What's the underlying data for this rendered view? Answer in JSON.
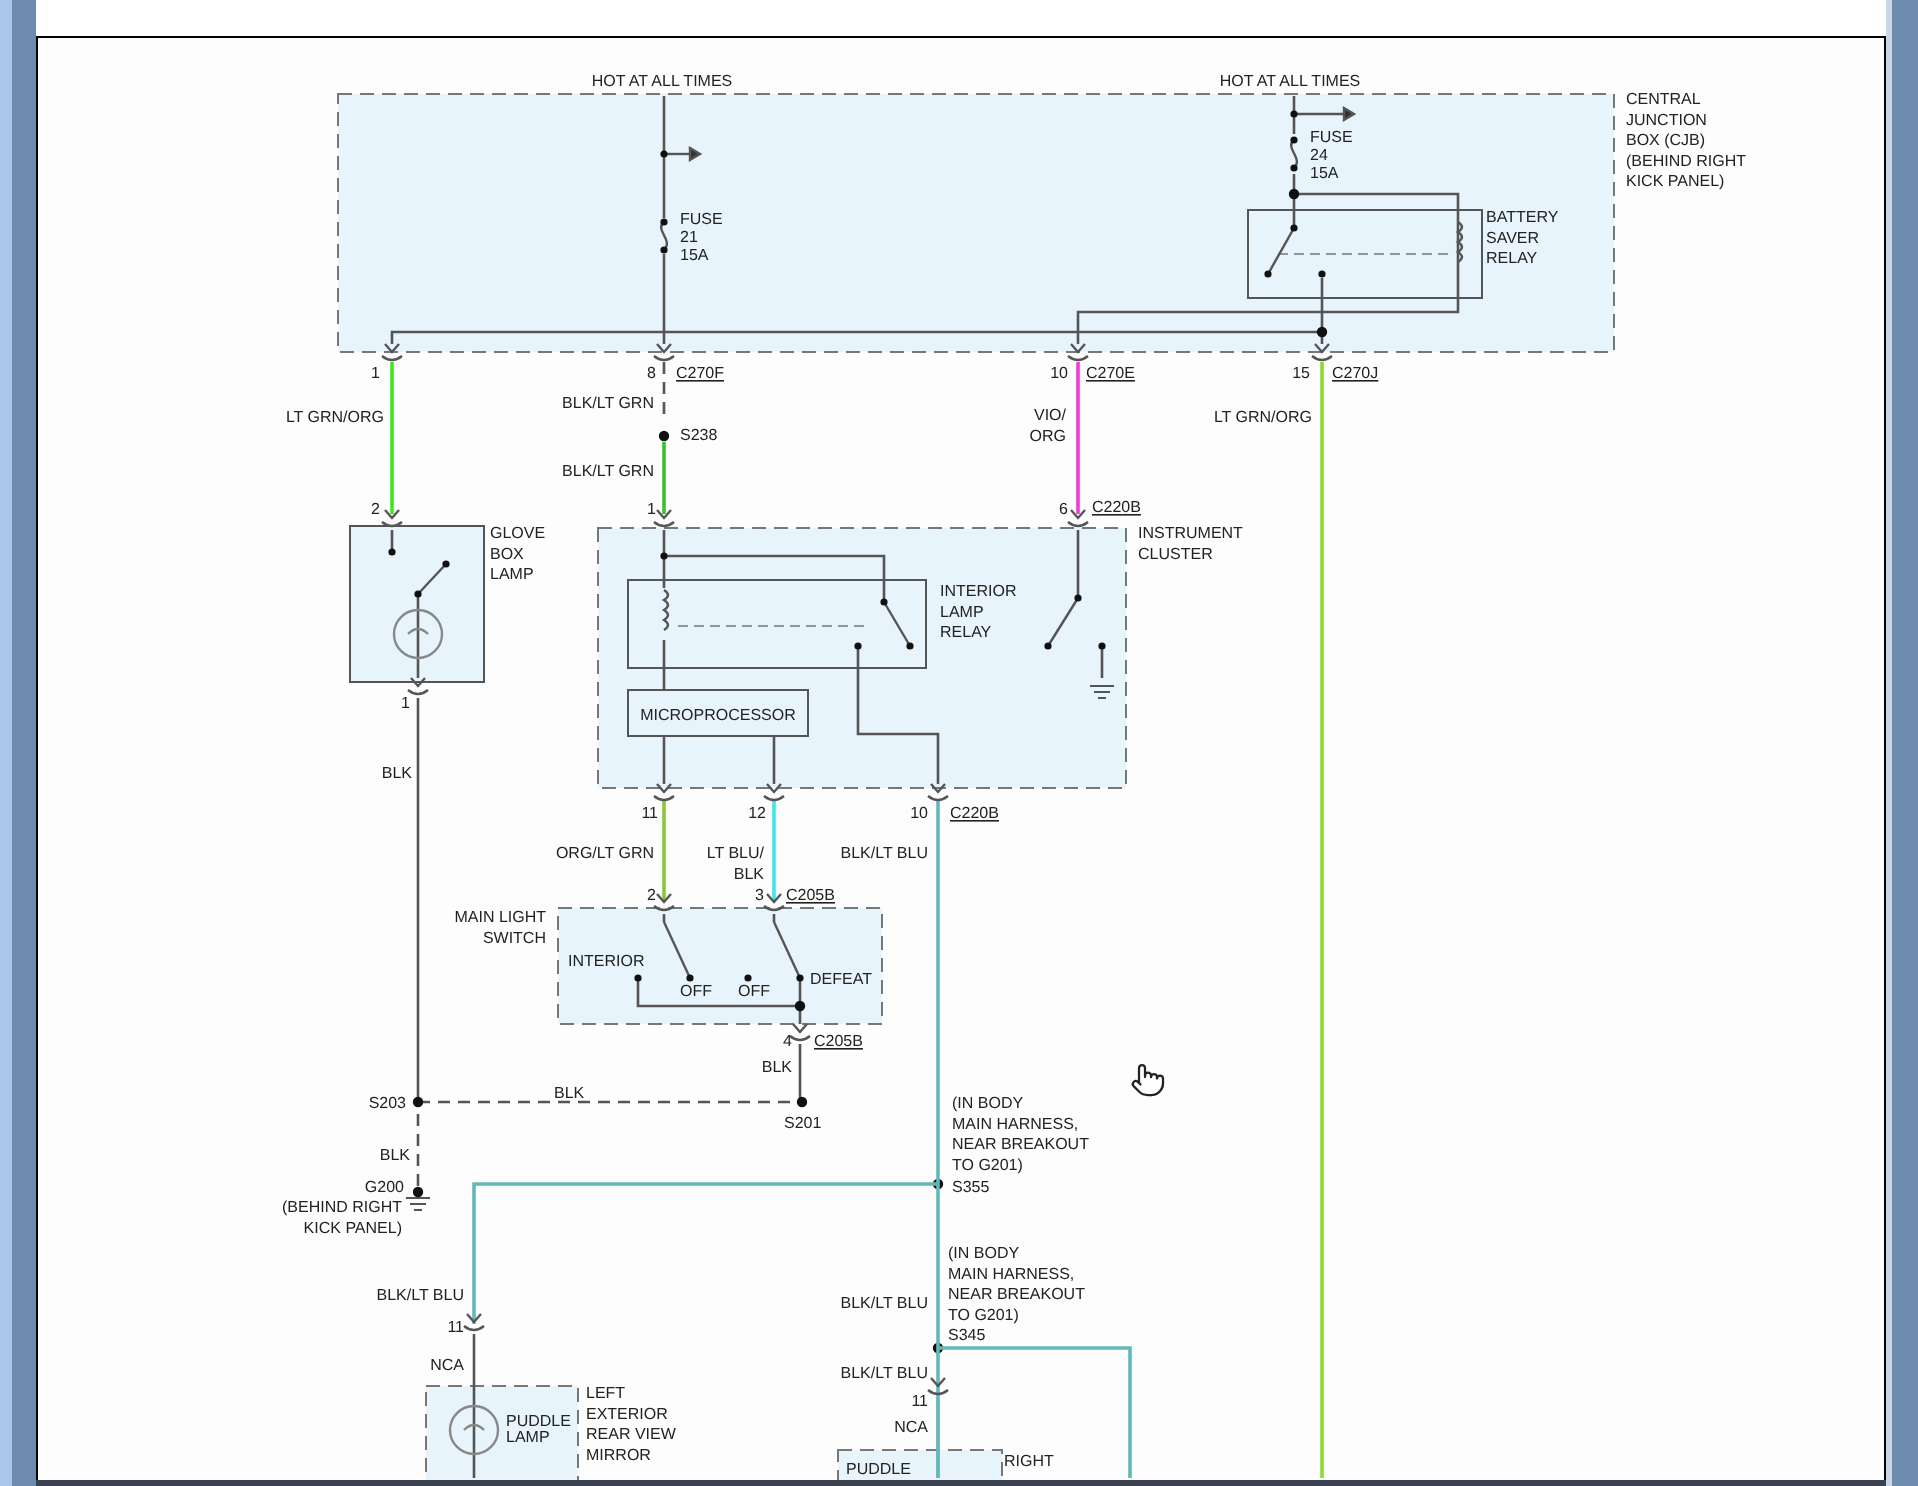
{
  "diagram": {
    "wires": [
      {
        "color": "#3fe61e"
      },
      {
        "color": "#35c22a"
      },
      {
        "color": "#f23ad8"
      },
      {
        "color": "#8fd92e"
      },
      {
        "color": "#86c83a"
      },
      {
        "color": "#3ee8e8"
      },
      {
        "color": "#63b8b8"
      }
    ],
    "labels": [
      {
        "kind": "note",
        "lines": [
          "HOT AT ALL TIMES"
        ]
      },
      {
        "kind": "note",
        "lines": [
          "HOT AT ALL TIMES"
        ]
      },
      {
        "kind": "component",
        "lines": [
          "CENTRAL",
          "JUNCTION",
          "BOX (CJB)",
          "(BEHIND RIGHT",
          "KICK PANEL)"
        ]
      },
      {
        "kind": "component",
        "lines": [
          "FUSE",
          "21",
          "15A"
        ]
      },
      {
        "kind": "component",
        "lines": [
          "FUSE",
          "24",
          "15A"
        ]
      },
      {
        "kind": "component",
        "lines": [
          "BATTERY",
          "SAVER",
          "RELAY"
        ]
      },
      {
        "kind": "pin",
        "lines": [
          "1"
        ]
      },
      {
        "kind": "pin",
        "lines": [
          "8"
        ]
      },
      {
        "kind": "connector",
        "lines": [
          "C270F"
        ]
      },
      {
        "kind": "pin",
        "lines": [
          "10"
        ]
      },
      {
        "kind": "connector",
        "lines": [
          "C270E"
        ]
      },
      {
        "kind": "pin",
        "lines": [
          "15"
        ]
      },
      {
        "kind": "connector",
        "lines": [
          "C270J"
        ]
      },
      {
        "kind": "wire",
        "lines": [
          "LT GRN/ORG"
        ]
      },
      {
        "kind": "wire",
        "lines": [
          "BLK/LT GRN"
        ]
      },
      {
        "kind": "splice",
        "lines": [
          "S238"
        ]
      },
      {
        "kind": "wire",
        "lines": [
          "BLK/LT GRN"
        ]
      },
      {
        "kind": "wire",
        "lines": [
          "VIO/",
          "ORG"
        ]
      },
      {
        "kind": "wire",
        "lines": [
          "LT GRN/ORG"
        ]
      },
      {
        "kind": "pin",
        "lines": [
          "2"
        ]
      },
      {
        "kind": "pin",
        "lines": [
          "1"
        ]
      },
      {
        "kind": "pin",
        "lines": [
          "6"
        ]
      },
      {
        "kind": "connector",
        "lines": [
          "C220B"
        ]
      },
      {
        "kind": "component",
        "lines": [
          "GLOVE",
          "BOX",
          "LAMP"
        ]
      },
      {
        "kind": "component",
        "lines": [
          "INSTRUMENT",
          "CLUSTER"
        ]
      },
      {
        "kind": "component",
        "lines": [
          "INTERIOR",
          "LAMP",
          "RELAY"
        ]
      },
      {
        "kind": "component",
        "lines": [
          "MICROPROCESSOR"
        ]
      },
      {
        "kind": "pin",
        "lines": [
          "1"
        ]
      },
      {
        "kind": "wire",
        "lines": [
          "BLK"
        ]
      },
      {
        "kind": "pin",
        "lines": [
          "11"
        ]
      },
      {
        "kind": "pin",
        "lines": [
          "12"
        ]
      },
      {
        "kind": "pin",
        "lines": [
          "10"
        ]
      },
      {
        "kind": "connector",
        "lines": [
          "C220B"
        ]
      },
      {
        "kind": "wire",
        "lines": [
          "ORG/LT GRN"
        ]
      },
      {
        "kind": "wire",
        "lines": [
          "LT BLU/",
          "BLK"
        ]
      },
      {
        "kind": "wire",
        "lines": [
          "BLK/LT BLU"
        ]
      },
      {
        "kind": "pin",
        "lines": [
          "2"
        ]
      },
      {
        "kind": "pin",
        "lines": [
          "3"
        ]
      },
      {
        "kind": "connector",
        "lines": [
          "C205B"
        ]
      },
      {
        "kind": "component",
        "lines": [
          "MAIN LIGHT",
          "SWITCH"
        ]
      },
      {
        "kind": "note",
        "lines": [
          "INTERIOR"
        ]
      },
      {
        "kind": "note",
        "lines": [
          "OFF"
        ]
      },
      {
        "kind": "note",
        "lines": [
          "OFF"
        ]
      },
      {
        "kind": "note",
        "lines": [
          "DEFEAT"
        ]
      },
      {
        "kind": "pin",
        "lines": [
          "4"
        ]
      },
      {
        "kind": "connector",
        "lines": [
          "C205B"
        ]
      },
      {
        "kind": "wire",
        "lines": [
          "BLK"
        ]
      },
      {
        "kind": "splice",
        "lines": [
          "S203"
        ]
      },
      {
        "kind": "wire",
        "lines": [
          "BLK"
        ]
      },
      {
        "kind": "splice",
        "lines": [
          "S201"
        ]
      },
      {
        "kind": "wire",
        "lines": [
          "BLK"
        ]
      },
      {
        "kind": "splice",
        "lines": [
          "G200"
        ]
      },
      {
        "kind": "note",
        "lines": [
          "(BEHIND RIGHT",
          "KICK PANEL)"
        ]
      },
      {
        "kind": "note",
        "lines": [
          "(IN BODY",
          "MAIN HARNESS,",
          "NEAR BREAKOUT",
          "TO G201)"
        ]
      },
      {
        "kind": "splice",
        "lines": [
          "S355"
        ]
      },
      {
        "kind": "note",
        "lines": [
          "(IN BODY",
          "MAIN HARNESS,",
          "NEAR BREAKOUT",
          "TO G201)"
        ]
      },
      {
        "kind": "splice",
        "lines": [
          "S345"
        ]
      },
      {
        "kind": "wire",
        "lines": [
          "BLK/LT BLU"
        ]
      },
      {
        "kind": "pin",
        "lines": [
          "11"
        ]
      },
      {
        "kind": "wire",
        "lines": [
          "NCA"
        ]
      },
      {
        "kind": "wire",
        "lines": [
          "BLK/LT BLU"
        ]
      },
      {
        "kind": "wire",
        "lines": [
          "BLK/LT BLU"
        ]
      },
      {
        "kind": "pin",
        "lines": [
          "11"
        ]
      },
      {
        "kind": "component",
        "lines": [
          "PUDDLE",
          "LAMP"
        ]
      },
      {
        "kind": "component",
        "lines": [
          "LEFT",
          "EXTERIOR",
          "REAR VIEW",
          "MIRROR"
        ]
      },
      {
        "kind": "wire",
        "lines": [
          "NCA"
        ]
      },
      {
        "kind": "component",
        "lines": [
          "PUDDLE"
        ]
      },
      {
        "kind": "component",
        "lines": [
          "RIGHT"
        ]
      }
    ]
  }
}
